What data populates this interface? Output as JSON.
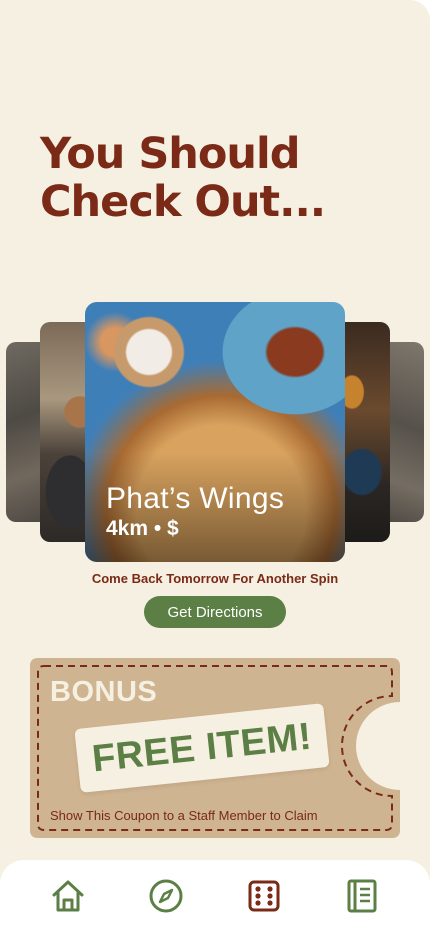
{
  "header": {
    "line1": "You Should",
    "line2": "Check Out..."
  },
  "carousel": {
    "featured": {
      "name": "Phat’s Wings",
      "meta": "4km • $"
    }
  },
  "spin_note": "Come Back Tomorrow For Another Spin",
  "directions_button": "Get Directions",
  "coupon": {
    "bonus": "BONUS",
    "offer": "FREE ITEM!",
    "instructions": "Show This Coupon to a Staff Member to Claim"
  },
  "nav": {
    "items": [
      {
        "icon": "home-icon"
      },
      {
        "icon": "compass-icon"
      },
      {
        "icon": "dice-icon",
        "active": true
      },
      {
        "icon": "menu-book-icon"
      }
    ]
  },
  "colors": {
    "background": "#f5f0e1",
    "headline": "#7a2a17",
    "accent_green": "#5b7f45",
    "coupon": "#cfb491",
    "active_nav": "#7a2a17"
  }
}
